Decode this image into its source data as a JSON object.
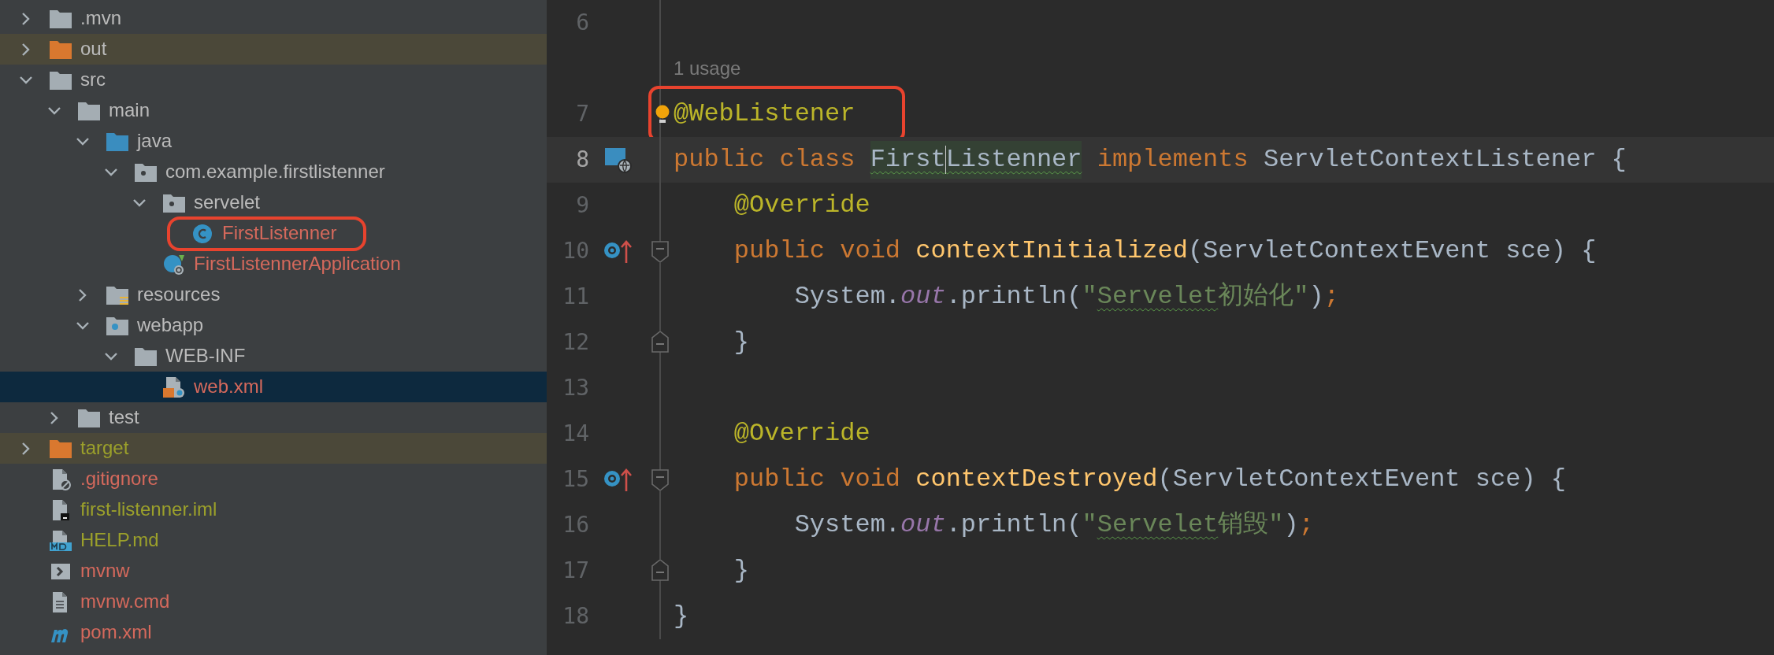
{
  "project_tree": {
    "items": [
      {
        "label": ".mvn",
        "kind": "folder",
        "color": "#bbbbbb",
        "expanded": false,
        "selected": false,
        "highlighted": false
      },
      {
        "label": "out",
        "kind": "excluded-folder",
        "color": "#bbbbbb",
        "expanded": false,
        "selected": false,
        "highlighted": false
      },
      {
        "label": "src",
        "kind": "folder",
        "color": "#bbbbbb",
        "expanded": true,
        "selected": false,
        "highlighted": false,
        "children": [
          {
            "label": "main",
            "kind": "folder",
            "color": "#bbbbbb",
            "expanded": true,
            "selected": false,
            "highlighted": false,
            "children": [
              {
                "label": "java",
                "kind": "source-folder",
                "color": "#bbbbbb",
                "expanded": true,
                "selected": false,
                "highlighted": false,
                "children": [
                  {
                    "label": "com.example.firstlistenner",
                    "kind": "package",
                    "color": "#bbbbbb",
                    "expanded": true,
                    "selected": false,
                    "highlighted": false,
                    "children": [
                      {
                        "label": "servelet",
                        "kind": "package",
                        "color": "#bbbbbb",
                        "expanded": true,
                        "selected": false,
                        "highlighted": false,
                        "children": [
                          {
                            "label": "FirstListenner",
                            "kind": "class",
                            "color": "#d5695c",
                            "selected": false,
                            "highlighted": true
                          }
                        ]
                      },
                      {
                        "label": "FirstListennerApplication",
                        "kind": "spring-class",
                        "color": "#d5695c",
                        "selected": false,
                        "highlighted": false
                      }
                    ]
                  }
                ]
              },
              {
                "label": "resources",
                "kind": "resources-folder",
                "color": "#bbbbbb",
                "expanded": false,
                "selected": false,
                "highlighted": false
              },
              {
                "label": "webapp",
                "kind": "web-folder",
                "color": "#bbbbbb",
                "expanded": true,
                "selected": false,
                "highlighted": false,
                "children": [
                  {
                    "label": "WEB-INF",
                    "kind": "folder",
                    "color": "#bbbbbb",
                    "expanded": true,
                    "selected": false,
                    "highlighted": false,
                    "children": [
                      {
                        "label": "web.xml",
                        "kind": "xml-file",
                        "color": "#d5695c",
                        "selected": true,
                        "highlighted": false
                      }
                    ]
                  }
                ]
              }
            ]
          },
          {
            "label": "test",
            "kind": "folder",
            "color": "#bbbbbb",
            "expanded": false,
            "selected": false,
            "highlighted": false
          }
        ]
      },
      {
        "label": "target",
        "kind": "excluded-folder",
        "color": "#9ba02b",
        "expanded": false,
        "selected": false,
        "highlighted": false
      },
      {
        "label": ".gitignore",
        "kind": "ignore-file",
        "color": "#d5695c",
        "selected": false,
        "highlighted": false
      },
      {
        "label": "first-listenner.iml",
        "kind": "iml-file",
        "color": "#9ba02b",
        "selected": false,
        "highlighted": false
      },
      {
        "label": "HELP.md",
        "kind": "markdown-file",
        "color": "#9ba02b",
        "selected": false,
        "highlighted": false
      },
      {
        "label": "mvnw",
        "kind": "shell-file",
        "color": "#d5695c",
        "selected": false,
        "highlighted": false
      },
      {
        "label": "mvnw.cmd",
        "kind": "text-file",
        "color": "#d5695c",
        "selected": false,
        "highlighted": false
      },
      {
        "label": "pom.xml",
        "kind": "maven-file",
        "color": "#d5695c",
        "selected": false,
        "highlighted": false
      }
    ]
  },
  "editor": {
    "lines": [
      {
        "number": "6",
        "current": false,
        "highlighted": false
      },
      {
        "number": "7",
        "inlay": "1 usage",
        "current": false,
        "highlighted": true,
        "tokens": [
          {
            "kind": "bulb"
          },
          {
            "kind": "annotation",
            "text": "@WebListener"
          }
        ]
      },
      {
        "number": "8",
        "gutter_icon": {
          "kind": "web-listener"
        },
        "current": true,
        "highlighted": false,
        "tokens": [
          {
            "kind": "keyword",
            "text": "public class "
          },
          {
            "kind": "declared-class",
            "text": "First"
          },
          {
            "kind": "caret"
          },
          {
            "kind": "declared-class",
            "text": "Listenner"
          },
          {
            "kind": "keyword",
            "text": " implements "
          },
          {
            "kind": "plain",
            "text": "ServletContextListener {"
          }
        ]
      },
      {
        "number": "9",
        "current": false,
        "highlighted": false,
        "tokens": [
          {
            "kind": "annotation",
            "text": "    @Override"
          }
        ]
      },
      {
        "number": "10",
        "gutter_icon": {
          "kind": "override"
        },
        "fold_mark": {
          "kind": "start"
        },
        "current": false,
        "highlighted": false,
        "tokens": [
          {
            "kind": "keyword",
            "text": "    public void "
          },
          {
            "kind": "method",
            "text": "contextInitialized"
          },
          {
            "kind": "plain",
            "text": "(ServletContextEvent sce) {"
          }
        ]
      },
      {
        "number": "11",
        "current": false,
        "highlighted": false,
        "tokens": [
          {
            "kind": "plain",
            "text": "        System."
          },
          {
            "kind": "field",
            "text": "out"
          },
          {
            "kind": "plain",
            "text": ".println("
          },
          {
            "kind": "string",
            "text": "\""
          },
          {
            "kind": "typo-string",
            "text": "Servelet"
          },
          {
            "kind": "string",
            "text": "初始化\""
          },
          {
            "kind": "plain",
            "text": ")"
          },
          {
            "kind": "keyword",
            "text": ";"
          }
        ]
      },
      {
        "number": "12",
        "fold_mark": {
          "kind": "end"
        },
        "current": false,
        "highlighted": false,
        "tokens": [
          {
            "kind": "plain",
            "text": "    }"
          }
        ]
      },
      {
        "number": "13",
        "current": false,
        "highlighted": false
      },
      {
        "number": "14",
        "current": false,
        "highlighted": false,
        "tokens": [
          {
            "kind": "annotation",
            "text": "    @Override"
          }
        ]
      },
      {
        "number": "15",
        "gutter_icon": {
          "kind": "override"
        },
        "fold_mark": {
          "kind": "start"
        },
        "current": false,
        "highlighted": false,
        "tokens": [
          {
            "kind": "keyword",
            "text": "    public void "
          },
          {
            "kind": "method",
            "text": "contextDestroyed"
          },
          {
            "kind": "plain",
            "text": "(ServletContextEvent sce) {"
          }
        ]
      },
      {
        "number": "16",
        "current": false,
        "highlighted": false,
        "tokens": [
          {
            "kind": "plain",
            "text": "        System."
          },
          {
            "kind": "field",
            "text": "out"
          },
          {
            "kind": "plain",
            "text": ".println("
          },
          {
            "kind": "string",
            "text": "\""
          },
          {
            "kind": "typo-string",
            "text": "Servelet"
          },
          {
            "kind": "string",
            "text": "销毁\""
          },
          {
            "kind": "plain",
            "text": ")"
          },
          {
            "kind": "keyword",
            "text": ";"
          }
        ]
      },
      {
        "number": "17",
        "fold_mark": {
          "kind": "end"
        },
        "current": false,
        "highlighted": false,
        "tokens": [
          {
            "kind": "plain",
            "text": "    }"
          }
        ]
      },
      {
        "number": "18",
        "current": false,
        "highlighted": false,
        "tokens": [
          {
            "kind": "plain",
            "text": "}"
          }
        ]
      }
    ]
  }
}
